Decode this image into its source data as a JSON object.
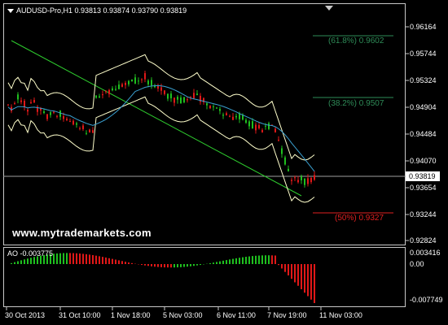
{
  "header": {
    "symbol_line": "AUDUSD-Pro,H1  0.93813 0.93874 0.93790 0.93819"
  },
  "price_axis": [
    "0.96164",
    "0.95744",
    "0.95324",
    "0.94904",
    "0.94484",
    "0.94070",
    "0.93654",
    "0.93244",
    "0.92824"
  ],
  "current_price": "0.93819",
  "fibonacci": [
    {
      "label": "(61.8%) 0.9602",
      "color": "#2e8b57"
    },
    {
      "label": "(38.2%) 0.9507",
      "color": "#2e8b57"
    },
    {
      "label": "(50%) 0.9327",
      "color": "#e02020"
    }
  ],
  "watermark": "www.mytrademarkets.com",
  "ao": {
    "label": "AO -0.003775",
    "axis": [
      "0.003416",
      "0.00",
      "-0.007749"
    ]
  },
  "time_axis": [
    "30 Oct 2013",
    "31 Oct 10:00",
    "1 Nov 18:00",
    "5 Nov 03:00",
    "6 Nov 11:00",
    "7 Nov 19:00",
    "11 Nov 03:00"
  ],
  "colors": {
    "bull": "#1fbf1f",
    "bear": "#e01818",
    "bands": "#ffffcc",
    "ma": "#3aa0d0",
    "trend": "#2ecc2e"
  }
}
